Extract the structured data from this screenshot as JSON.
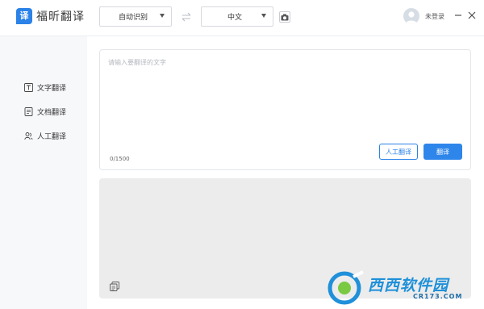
{
  "app": {
    "logo_badge": "译",
    "title": "福昕翻译"
  },
  "toolbar": {
    "source_language": "自动识别",
    "target_language": "中文",
    "login_text": "未登录"
  },
  "sidebar": {
    "items": [
      {
        "label": "文字翻译",
        "icon": "text-translate-icon"
      },
      {
        "label": "文档翻译",
        "icon": "document-translate-icon"
      },
      {
        "label": "人工翻译",
        "icon": "human-translate-icon"
      }
    ]
  },
  "input": {
    "placeholder": "请输入要翻译的文字",
    "value": "",
    "counter": "0/1500",
    "human_button": "人工翻译",
    "translate_button": "翻译"
  },
  "output": {
    "text": ""
  },
  "watermark": {
    "text": "西西软件园",
    "sub": "CR173.COM"
  },
  "colors": {
    "accent": "#2b82e8",
    "sidebar_bg": "#f7f8fa",
    "output_bg": "#ececec"
  }
}
